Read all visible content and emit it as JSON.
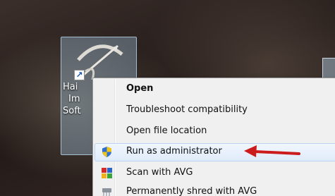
{
  "desktop": {
    "shortcut": {
      "label_lines": [
        "Hai",
        "Im",
        "Soft"
      ]
    }
  },
  "context_menu": {
    "items": [
      {
        "label": "Open",
        "icon": "",
        "default": true
      },
      {
        "label": "Troubleshoot compatibility",
        "icon": ""
      },
      {
        "label": "Open file location",
        "icon": ""
      },
      {
        "label": "Run as administrator",
        "icon": "uac-shield-icon",
        "highlighted": true
      },
      {
        "label": "Scan with AVG",
        "icon": "avg-icon"
      },
      {
        "label": "Permanently shred with AVG",
        "icon": "shred-icon"
      }
    ]
  },
  "annotation": {
    "color": "#cc1b1b",
    "points_to": "Run as administrator"
  }
}
